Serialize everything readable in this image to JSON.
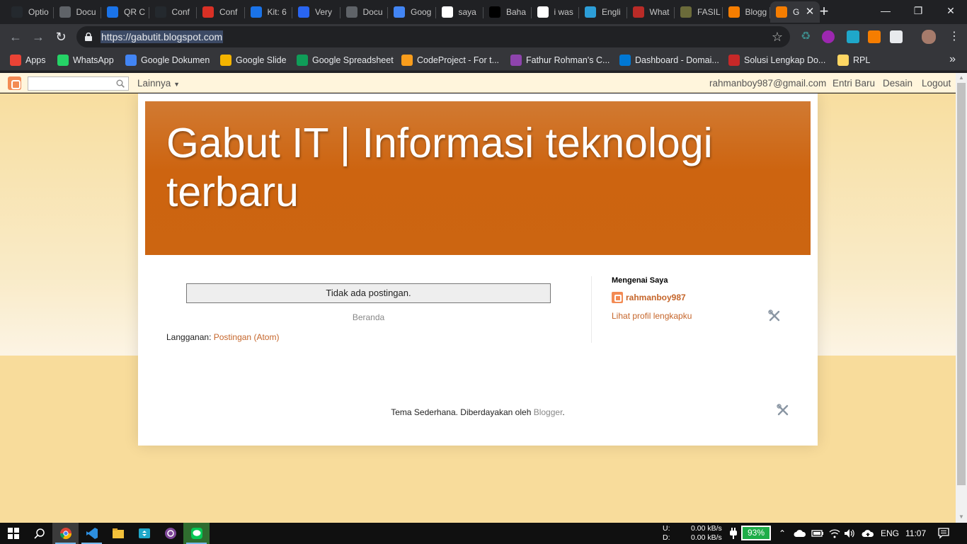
{
  "browser": {
    "tabs": [
      {
        "label": "Optio",
        "icon": "github-icon",
        "color": "#24292e"
      },
      {
        "label": "Docu",
        "icon": "globe-icon",
        "color": "#5f6368"
      },
      {
        "label": "QR C",
        "icon": "qr-icon",
        "color": "#1a73e8"
      },
      {
        "label": "Conf",
        "icon": "github-icon",
        "color": "#24292e"
      },
      {
        "label": "Conf",
        "icon": "gmail-icon",
        "color": "#d93025"
      },
      {
        "label": "Kit: 6",
        "icon": "flag-icon",
        "color": "#1a73e8"
      },
      {
        "label": "Very",
        "icon": "css-icon",
        "color": "#2965f1"
      },
      {
        "label": "Docu",
        "icon": "globe-icon",
        "color": "#5f6368"
      },
      {
        "label": "Goog",
        "icon": "translate-icon",
        "color": "#4285f4"
      },
      {
        "label": "saya",
        "icon": "google-icon",
        "color": "#ffffff"
      },
      {
        "label": "Baha",
        "icon": "bold-b-icon",
        "color": "#000000"
      },
      {
        "label": "i was",
        "icon": "google-icon",
        "color": "#ffffff"
      },
      {
        "label": "Engli",
        "icon": "ev-icon",
        "color": "#2c9ed8"
      },
      {
        "label": "What",
        "icon": "quora-icon",
        "color": "#b92b27"
      },
      {
        "label": "FASIL",
        "icon": "grad-cap-icon",
        "color": "#6b6b3a"
      },
      {
        "label": "Blogg",
        "icon": "blogger-icon",
        "color": "#f57d00"
      }
    ],
    "active_tab": {
      "label": "G",
      "icon": "blogger-icon",
      "color": "#f57d00"
    },
    "close_glyph": "✕",
    "new_tab_glyph": "+",
    "url": "https://gabutit.blogspot.com",
    "bookmarks": [
      {
        "label": "Apps",
        "icon": "apps-grid-icon",
        "color": "#ea4335"
      },
      {
        "label": "WhatsApp",
        "icon": "whatsapp-icon",
        "color": "#25d366"
      },
      {
        "label": "Google Dokumen",
        "icon": "docs-icon",
        "color": "#4285f4"
      },
      {
        "label": "Google Slide",
        "icon": "slides-icon",
        "color": "#f4b400"
      },
      {
        "label": "Google Spreadsheet",
        "icon": "sheets-icon",
        "color": "#0f9d58"
      },
      {
        "label": "CodeProject - For t...",
        "icon": "codeproject-icon",
        "color": "#f99d1c"
      },
      {
        "label": "Fathur Rohman's C...",
        "icon": "chrome-circle-icon",
        "color": "#8e44ad"
      },
      {
        "label": "Dashboard - Domai...",
        "icon": "dn-icon",
        "color": "#0078d4"
      },
      {
        "label": "Solusi Lengkap Do...",
        "icon": "chevron-red-icon",
        "color": "#c62828"
      },
      {
        "label": "RPL",
        "icon": "folder-icon",
        "color": "#fdd663"
      }
    ],
    "bookmarks_more": "»"
  },
  "navbar": {
    "more_label": "Lainnya",
    "email": "rahmanboy987@gmail.com",
    "new_post": "Entri Baru",
    "design": "Desain",
    "logout": "Logout"
  },
  "blog": {
    "title": "Gabut IT | Informasi teknologi terbaru",
    "no_posts": "Tidak ada postingan.",
    "home_link": "Beranda",
    "subscribe_label": "Langganan: ",
    "subscribe_link": "Postingan (Atom)",
    "about_title": "Mengenai Saya",
    "profile_name": "rahmanboy987",
    "profile_link": "Lihat profil lengkapku",
    "footer_text": "Tema Sederhana. Diberdayakan oleh ",
    "footer_link": "Blogger",
    "footer_end": "."
  },
  "taskbar": {
    "upload_label": "U:",
    "download_label": "D:",
    "upload_speed": "0.00 kB/s",
    "download_speed": "0.00 kB/s",
    "battery": "93%",
    "language": "ENG",
    "time": "11:07"
  },
  "colors": {
    "header_orange": "#cc6511",
    "link_orange": "#c5652a",
    "page_background": "#f8e0a0"
  }
}
